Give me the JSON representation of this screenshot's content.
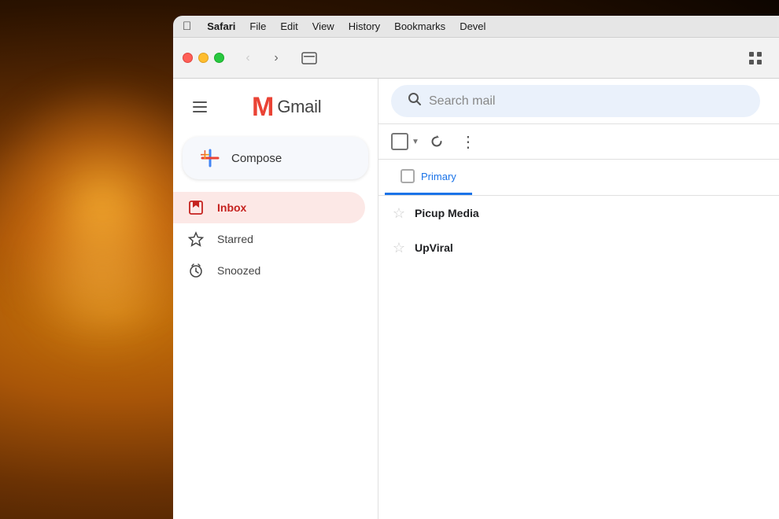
{
  "background": {
    "description": "Warm bokeh background with candle/fire light"
  },
  "menubar": {
    "apple": "&#xF8FF;",
    "items": [
      {
        "id": "safari",
        "label": "Safari",
        "bold": true
      },
      {
        "id": "file",
        "label": "File"
      },
      {
        "id": "edit",
        "label": "Edit"
      },
      {
        "id": "view",
        "label": "View"
      },
      {
        "id": "history",
        "label": "History"
      },
      {
        "id": "bookmarks",
        "label": "Bookmarks"
      },
      {
        "id": "develop",
        "label": "Devel"
      }
    ]
  },
  "browser_toolbar": {
    "back_title": "Back",
    "forward_title": "Forward",
    "tab_overview_title": "Tab Overview",
    "grid_title": "Grid View"
  },
  "gmail": {
    "logo_m": "M",
    "logo_text": "Gmail",
    "compose_label": "Compose",
    "search_placeholder": "Search mail",
    "nav_items": [
      {
        "id": "inbox",
        "label": "Inbox",
        "active": true,
        "icon": "inbox"
      },
      {
        "id": "starred",
        "label": "Starred",
        "active": false,
        "icon": "star"
      },
      {
        "id": "snoozed",
        "label": "Snoozed",
        "active": false,
        "icon": "clock"
      }
    ],
    "email_tab": {
      "label": "Primary",
      "active": true
    },
    "email_rows": [
      {
        "sender": "Picup Media",
        "partial": true
      },
      {
        "sender": "UpViral",
        "partial": true
      }
    ],
    "action_bar": {
      "refresh_label": "Refresh",
      "more_label": "More options"
    }
  }
}
